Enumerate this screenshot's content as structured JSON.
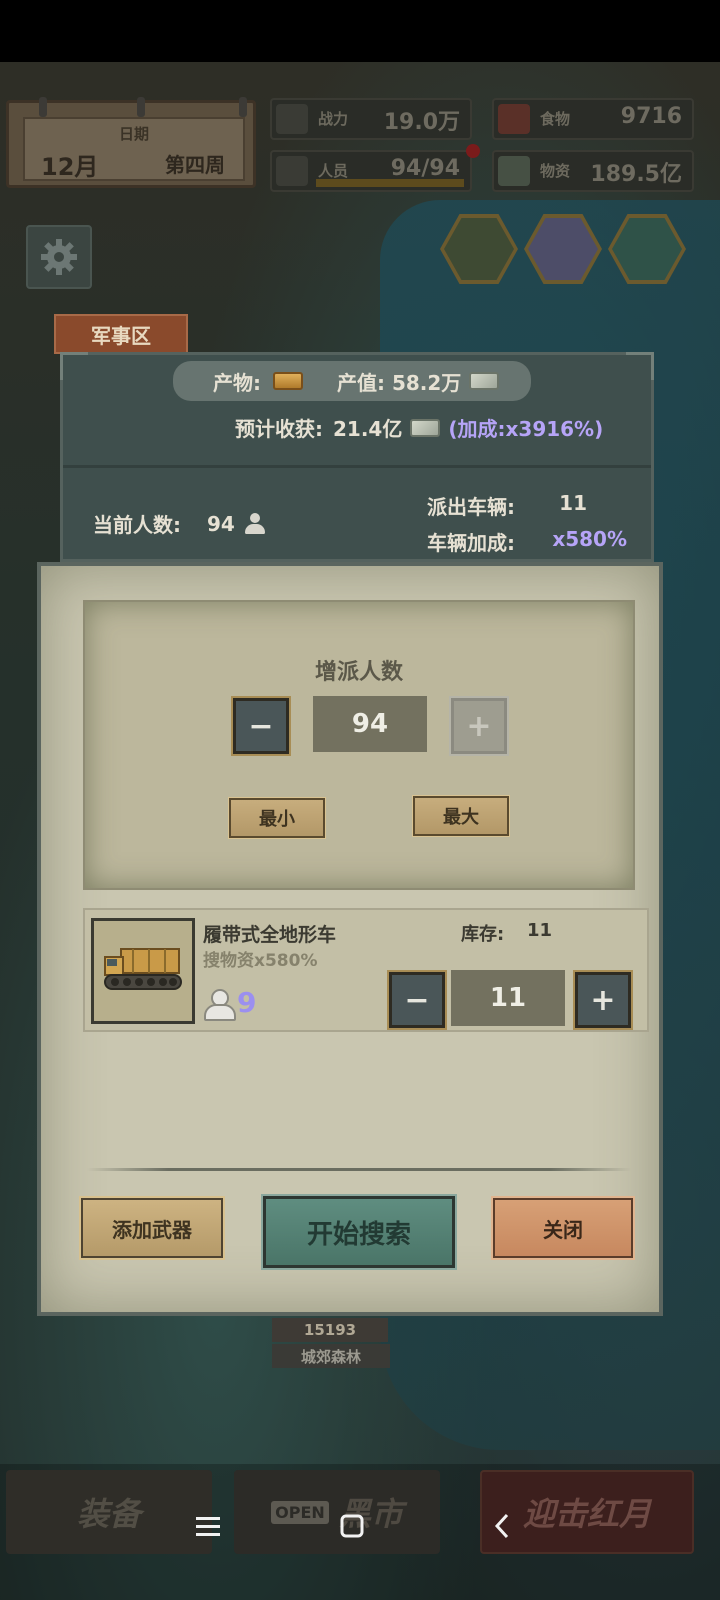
{
  "hud": {
    "date_label": "日期",
    "month": "12月",
    "week": "第四周",
    "power_label": "战力",
    "power_value": "19.0万",
    "personnel_label": "人员",
    "personnel_value": "94/94",
    "food_label": "食物",
    "food_value": "9716",
    "supplies_label": "物资",
    "supplies_value": "189.5亿"
  },
  "zone_tag": "军事区",
  "info": {
    "product_label": "产物:",
    "output_label": "产值: 58.2万",
    "estimate_label": "预计收获:",
    "estimate_value": "21.4亿",
    "estimate_bonus": "(加成:x3916%)",
    "current_people_label": "当前人数:",
    "current_people_value": "94",
    "vehicles_sent_label": "派出车辆:",
    "vehicles_sent_value": "11",
    "vehicle_bonus_label": "车辆加成:",
    "vehicle_bonus_value": "x580%"
  },
  "assign": {
    "title": "增派人数",
    "minus": "−",
    "value": "94",
    "plus": "+",
    "min_label": "最小",
    "max_label": "最大"
  },
  "vehicle": {
    "name": "履带式全地形车",
    "bonus": "搜物资x580%",
    "stock_label": "库存:",
    "stock_value": "11",
    "crew": "9",
    "minus": "−",
    "count": "11",
    "plus": "+"
  },
  "footer": {
    "add_weapon": "添加武器",
    "start_search": "开始搜索",
    "close": "关闭"
  },
  "map": {
    "location_power": "15193",
    "location_name": "城郊森林"
  },
  "bottom": {
    "equip": "装备",
    "open_sign": "OPEN",
    "black_market": "黑市",
    "strike": "迎击红月"
  },
  "colors": {
    "accent_purple": "#b6a4f7",
    "search_green": "#5f8d80",
    "close_orange": "#d7a076"
  }
}
